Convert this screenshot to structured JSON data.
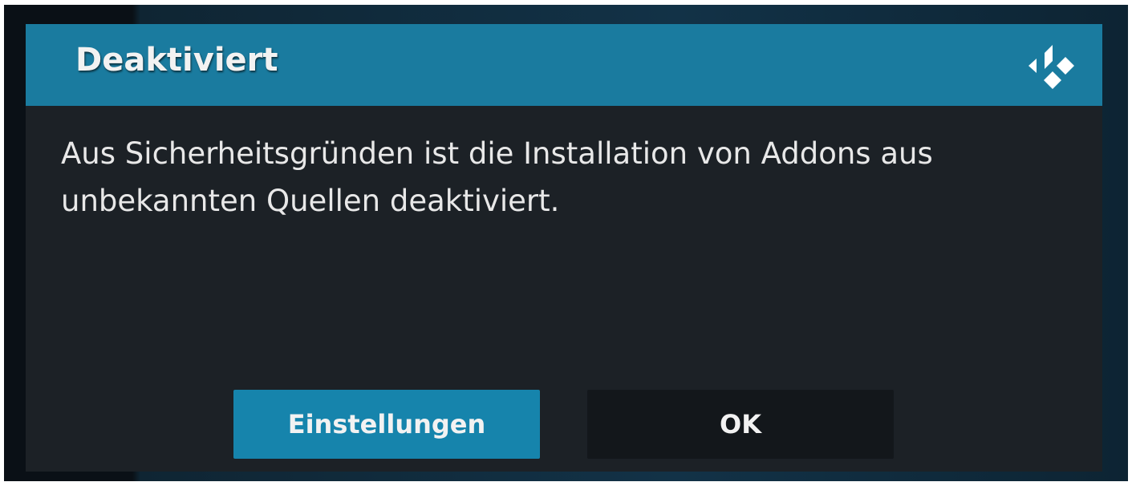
{
  "dialog": {
    "title": "Deaktiviert",
    "logo_icon": "kodi-logo-icon",
    "message": "Aus Sicherheitsgründen ist die Installation von Addons aus unbekannten Quellen deaktiviert.",
    "buttons": {
      "settings": "Einstellungen",
      "ok": "OK"
    }
  },
  "colors": {
    "header": "#1a7b9f",
    "background": "#1c2126",
    "focused_button": "#1684ac",
    "button": "#13171b"
  }
}
